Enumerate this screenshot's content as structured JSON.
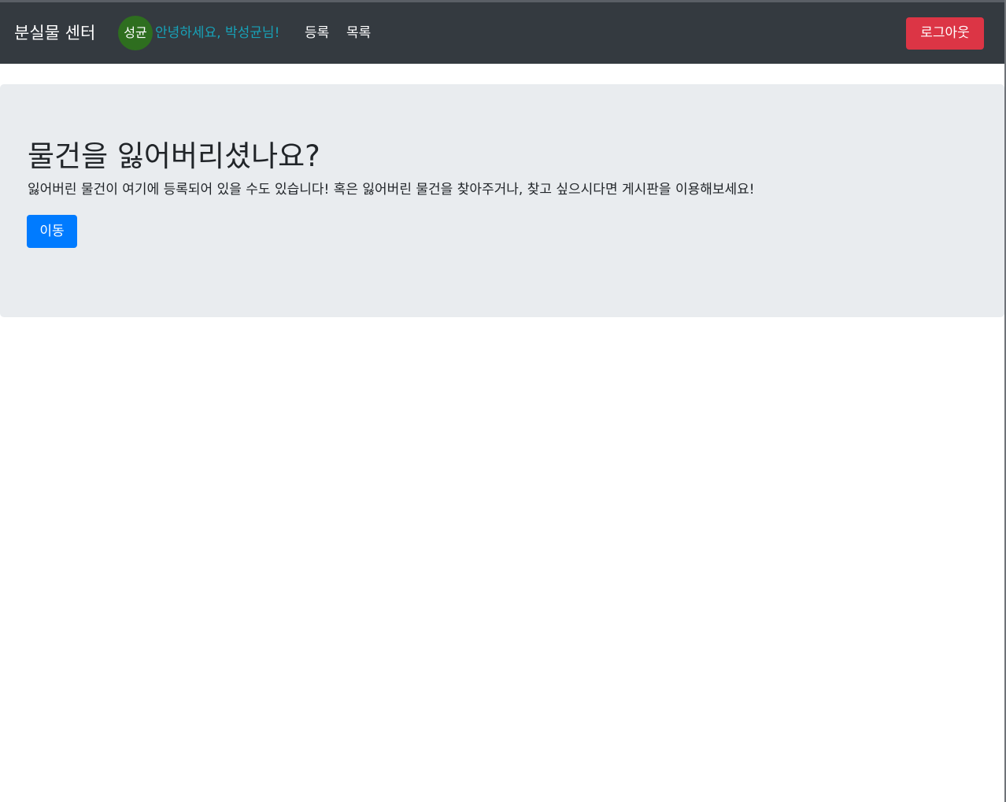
{
  "navbar": {
    "brand": "분실물 센터",
    "avatar_text": "성균",
    "greeting": "안녕하세요, 박성균님!",
    "links": {
      "register": "등록",
      "list": "목록"
    },
    "logout_label": "로그아웃"
  },
  "jumbotron": {
    "title": "물건을 잃어버리셨나요?",
    "text": "잃어버린 물건이 여기에 등록되어 있을 수도 있습니다! 혹은 잃어버린 물건을 찾아주거나, 찾고 싶으시다면 게시판을 이용해보세요!",
    "button_label": "이동"
  },
  "colors": {
    "navbar_bg": "#343a40",
    "greeting": "#17a2b8",
    "logout_bg": "#dc3545",
    "primary": "#007bff",
    "avatar_bg": "#2e6e1f",
    "jumbotron_bg": "#e9ecef"
  }
}
